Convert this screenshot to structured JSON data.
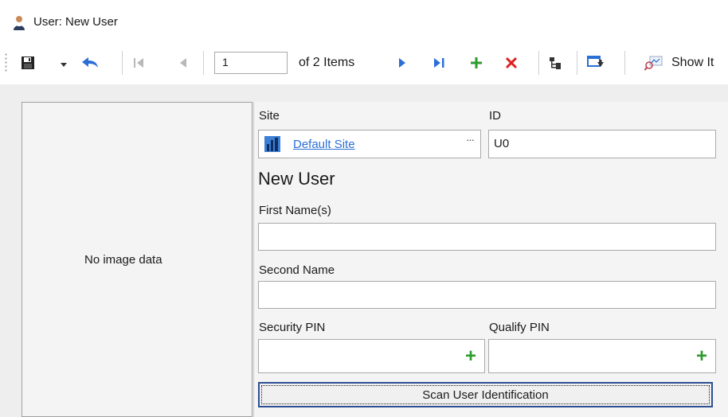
{
  "window": {
    "title": "User: New User",
    "icon": "user-icon"
  },
  "toolbar": {
    "save_icon": "save-icon",
    "dropdown_icon": "dropdown-arrow-icon",
    "undo_icon": "undo-icon",
    "first_icon": "first-record-icon",
    "prev_icon": "previous-record-icon",
    "position_value": "1",
    "of_items_label": "of 2 Items",
    "next_icon": "next-record-icon",
    "last_icon": "last-record-icon",
    "add_icon": "add-icon",
    "delete_icon": "delete-icon",
    "hierarchy_icon": "hierarchy-icon",
    "export_icon": "export-icon",
    "show_label": "Show It",
    "colors": {
      "blue": "#2a6fd6",
      "green": "#2e9b2e",
      "red": "#e02020"
    }
  },
  "image_panel": {
    "empty_label": "No image data"
  },
  "form": {
    "site_label": "Site",
    "site_value": "Default Site",
    "site_browse_label": "···",
    "id_label": "ID",
    "id_value": "U0",
    "heading": "New User",
    "first_name_label": "First Name(s)",
    "first_name_value": "",
    "second_name_label": "Second Name",
    "second_name_value": "",
    "security_pin_label": "Security PIN",
    "security_pin_value": "",
    "qualify_pin_label": "Qualify PIN",
    "qualify_pin_value": "",
    "plus_label": "+",
    "scan_button_label": "Scan User Identification"
  }
}
